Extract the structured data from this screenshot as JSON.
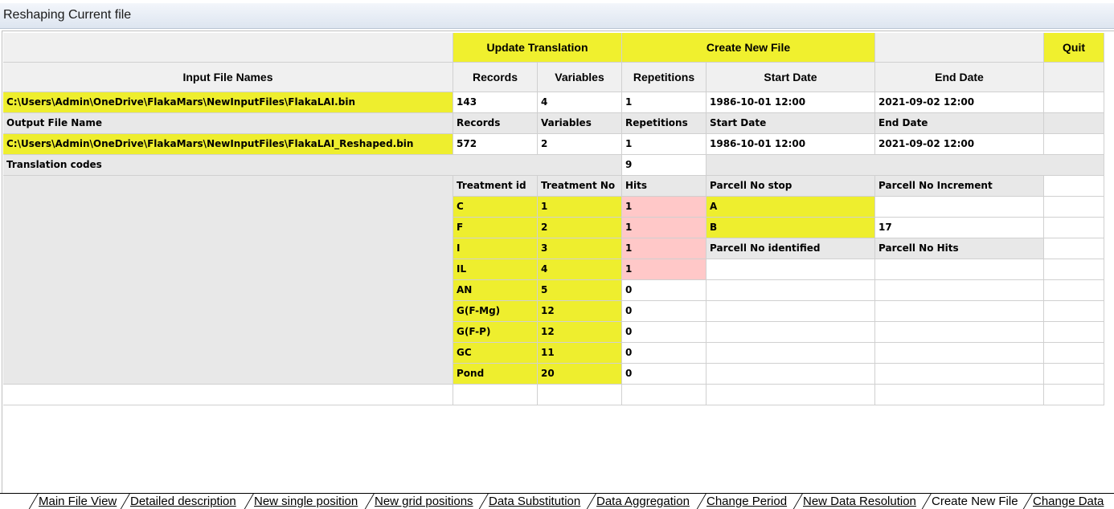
{
  "window": {
    "title": "Reshaping Current file"
  },
  "buttons": {
    "update_translation": "Update Translation",
    "create_new_file": "Create New File",
    "quit": "Quit"
  },
  "input_header": {
    "names": "Input File Names",
    "records": "Records",
    "variables": "Variables",
    "repetitions": "Repetitions",
    "start_date": "Start Date",
    "end_date": "End Date"
  },
  "input_row": {
    "path": "C:\\Users\\Admin\\OneDrive\\FlakaMars\\NewInputFiles\\FlakaLAI.bin",
    "records": "143",
    "variables": "4",
    "repetitions": "1",
    "start_date": "1986-10-01 12:00",
    "end_date": "2021-09-02 12:00"
  },
  "output_header": {
    "name": "Output File Name",
    "records": "Records",
    "variables": "Variables",
    "repetitions": "Repetitions",
    "start_date": "Start Date",
    "end_date": "End Date"
  },
  "output_row": {
    "path": "C:\\Users\\Admin\\OneDrive\\FlakaMars\\NewInputFiles\\FlakaLAI_Reshaped.bin",
    "records": "572",
    "variables": "2",
    "repetitions": "1",
    "start_date": "1986-10-01 12:00",
    "end_date": "2021-09-02 12:00"
  },
  "translation": {
    "label": "Translation codes",
    "count": "9",
    "col_treatment_id": "Treatment id",
    "col_treatment_no": "Treatment No",
    "col_hits": "Hits",
    "col_parcell_stop": "Parcell No stop",
    "col_parcell_increment": "Parcell No Increment",
    "rows": [
      {
        "id": "C",
        "no": "1",
        "hits": "1"
      },
      {
        "id": "F",
        "no": "2",
        "hits": "1"
      },
      {
        "id": "I",
        "no": "3",
        "hits": "1"
      },
      {
        "id": "IL",
        "no": "4",
        "hits": "1"
      },
      {
        "id": "AN",
        "no": "5",
        "hits": "0"
      },
      {
        "id": "G(F-Mg)",
        "no": "12",
        "hits": "0"
      },
      {
        "id": "G(F-P)",
        "no": "12",
        "hits": "0"
      },
      {
        "id": "GC",
        "no": "11",
        "hits": "0"
      },
      {
        "id": "Pond",
        "no": "20",
        "hits": "0"
      }
    ],
    "parcell_stop_a": "A",
    "parcell_stop_b": "B",
    "parcell_increment_b": "17",
    "col_parcell_identified": "Parcell No identified",
    "col_parcell_hits": "Parcell No Hits"
  },
  "tabs": [
    "Main File View",
    "Detailed description",
    "New single position",
    "New grid positions",
    "Data Substitution",
    "Data Aggregation",
    "Change Period",
    "New Data Resolution",
    "Create New File",
    "Change Data"
  ],
  "active_tab": "Create New File",
  "colors": {
    "button_yellow": "#f0f02e",
    "cell_yellow": "#eeee2e",
    "hits_pink": "#ffc8c8",
    "header_gray": "#f0f0f0",
    "panel_gray": "#e8e8e8"
  }
}
